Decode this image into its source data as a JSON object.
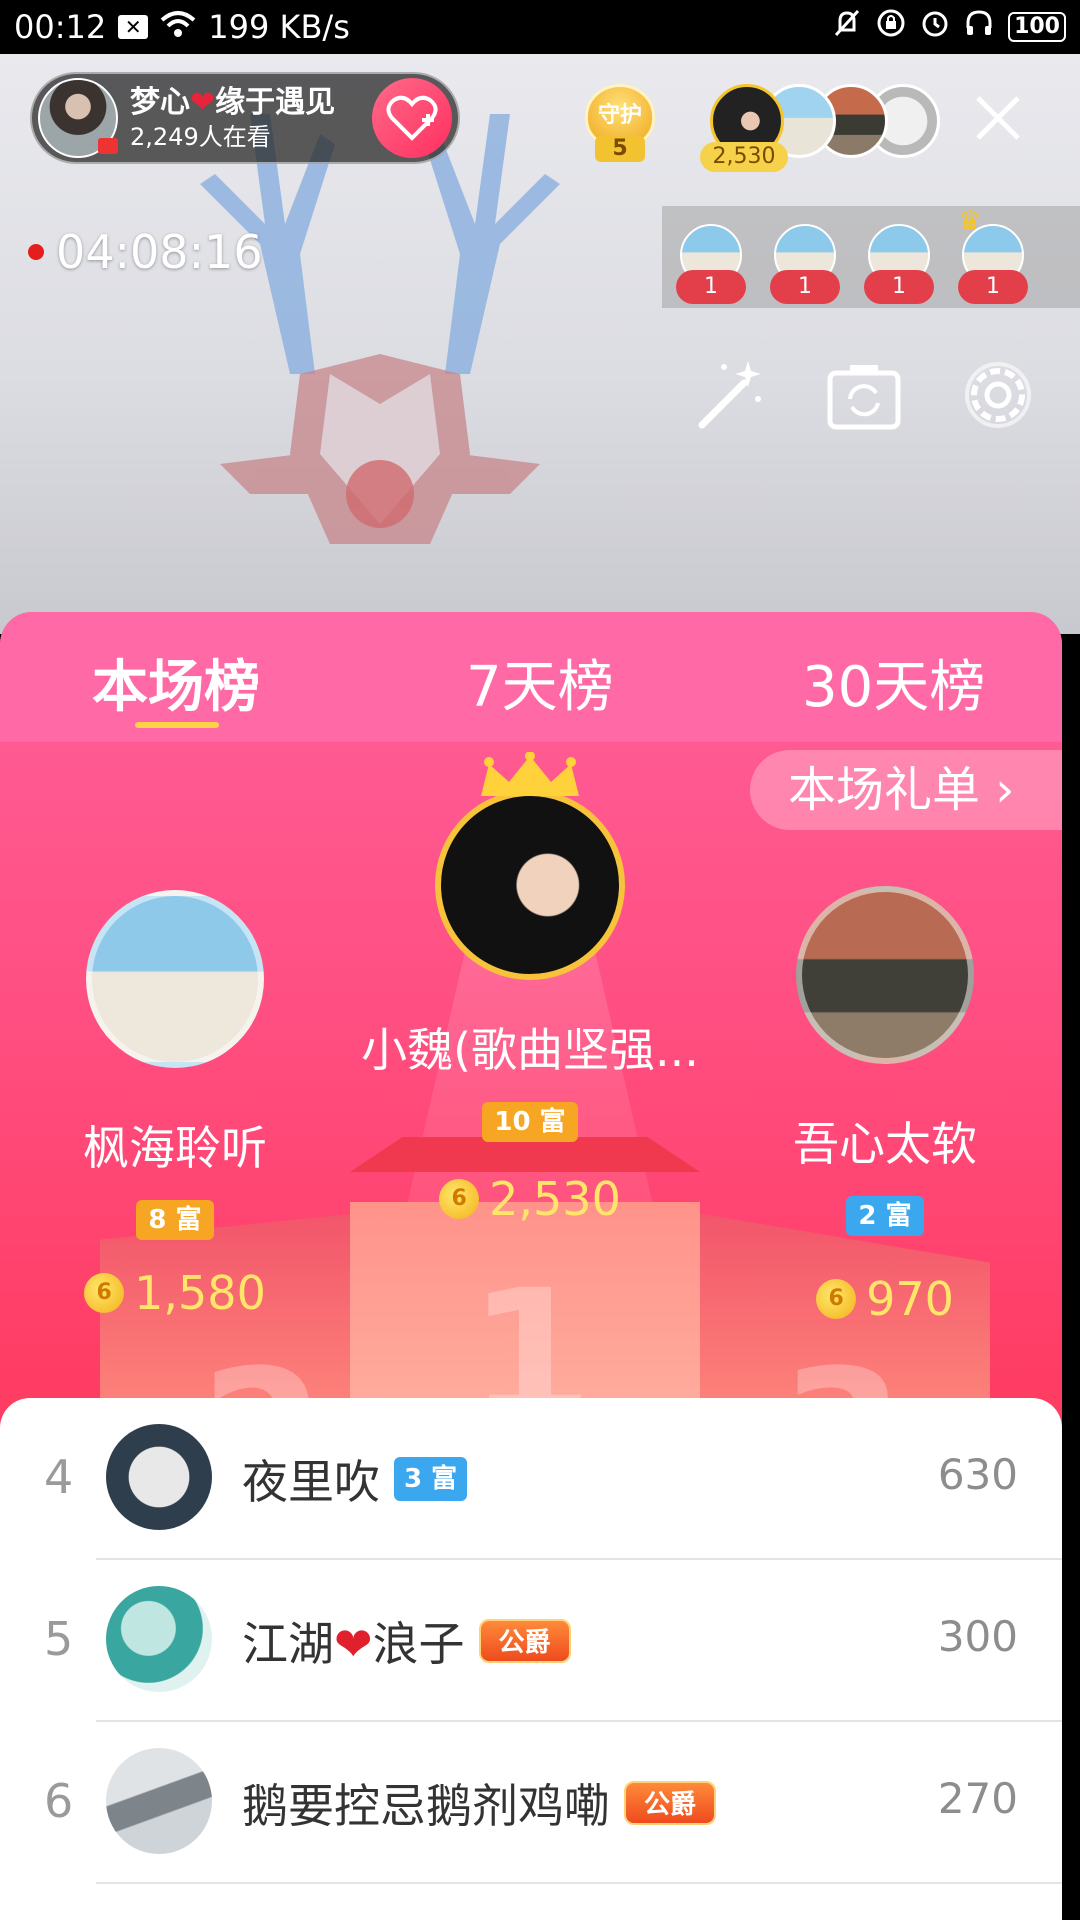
{
  "status_bar": {
    "time": "00:12",
    "notif_icon": "x-box-icon",
    "net_speed": "199 KB/s",
    "battery": "100"
  },
  "host": {
    "name_part1": "梦心",
    "name_heart": "❤",
    "name_part2": "缘于遇见",
    "viewers": "2,249人在看"
  },
  "guard": {
    "label": "守护",
    "count": "5"
  },
  "top_viewers": {
    "score": "2,530"
  },
  "timer": "04:08:16",
  "mic_users": [
    {
      "badge": "1"
    },
    {
      "badge": "1"
    },
    {
      "badge": "1"
    },
    {
      "badge": "1"
    }
  ],
  "tabs": [
    {
      "label": "本场榜",
      "active": true
    },
    {
      "label": "7天榜",
      "active": false
    },
    {
      "label": "30天榜",
      "active": false
    }
  ],
  "gift_list_button": "本场礼单 ›",
  "podium": {
    "first": {
      "name": "小魏(歌曲坚强...",
      "level": "10 富",
      "coins": "2,530"
    },
    "second": {
      "name": "枫海聆听",
      "level": "8 富",
      "coins": "1,580"
    },
    "third": {
      "name": "吾心太软",
      "level": "2 富",
      "coins": "970"
    },
    "rank_numbers": [
      "1",
      "2",
      "3"
    ]
  },
  "list": [
    {
      "rank": "4",
      "name": "夜里吹",
      "badge": "3 富",
      "badge_type": "blue",
      "value": "630"
    },
    {
      "rank": "5",
      "name_part1": "江湖",
      "name_heart": "❤",
      "name_part2": "浪子",
      "badge": "公爵",
      "badge_type": "duke",
      "value": "300"
    },
    {
      "rank": "6",
      "name": "鹅要控忌鹅剂鸡嘞",
      "badge": "公爵",
      "badge_type": "duke",
      "value": "270"
    }
  ],
  "colors": {
    "panel_pink": "#ff5f9b",
    "accent_red": "#f63a55",
    "coin_yellow": "#ffe66b",
    "tab_underline": "#ffd24a"
  }
}
